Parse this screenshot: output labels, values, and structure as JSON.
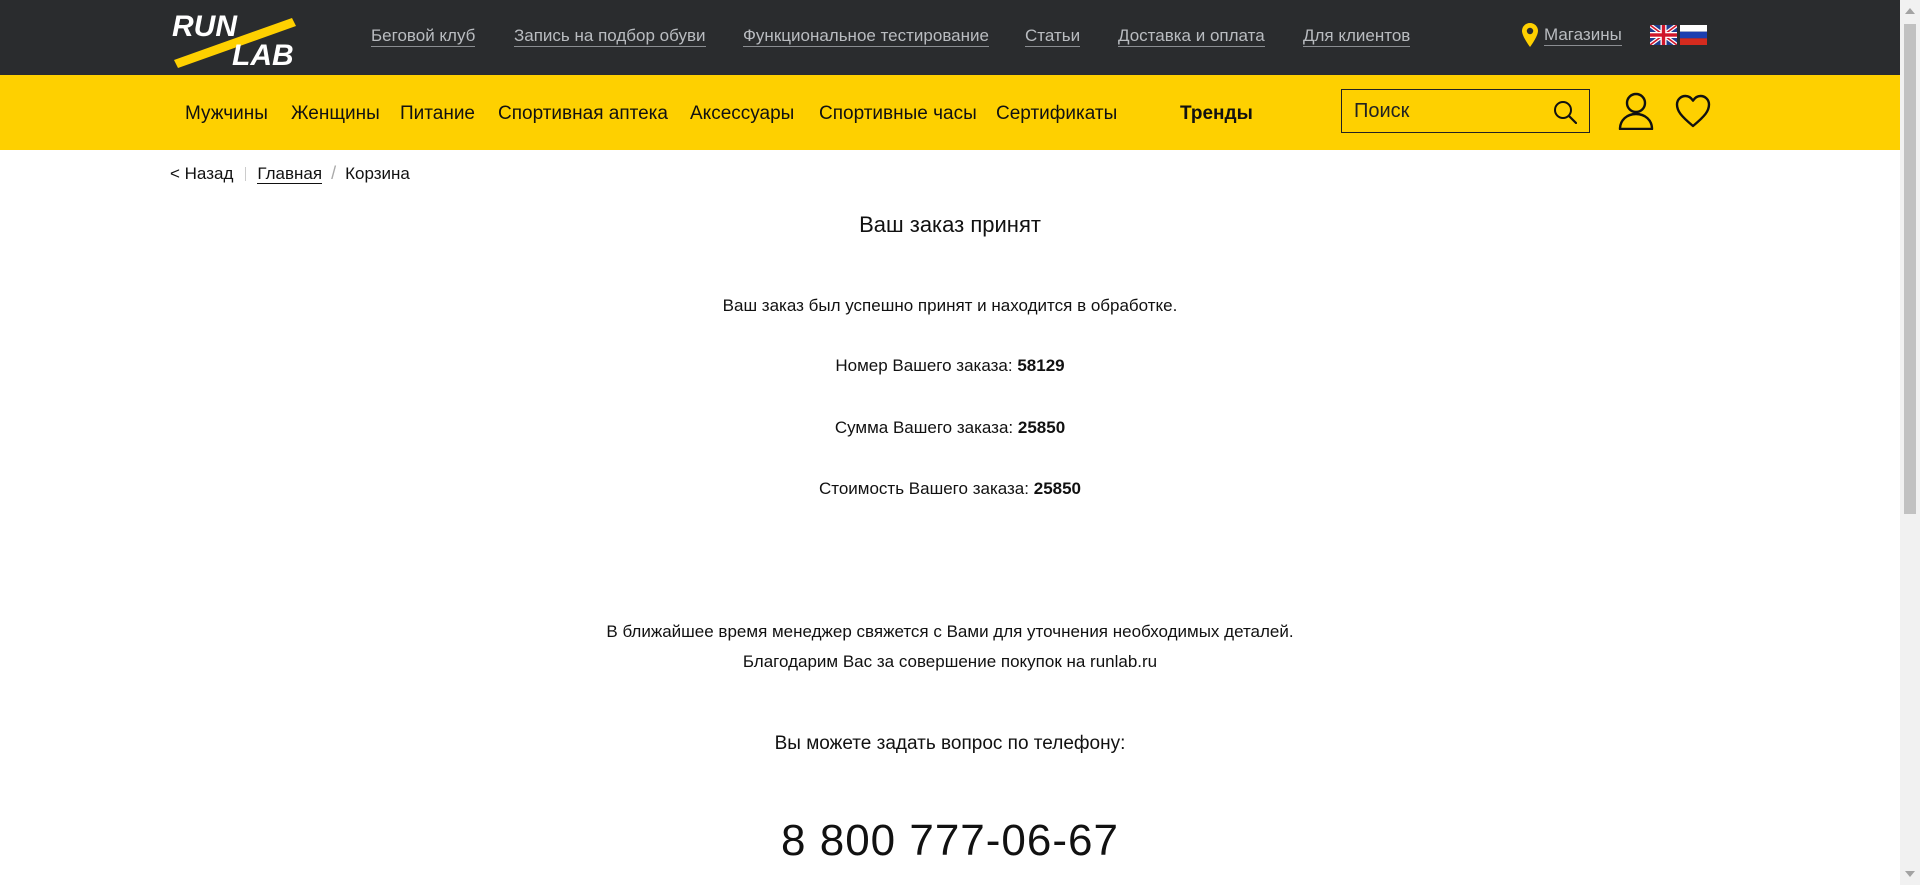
{
  "header": {
    "logo_text_top": "RUN",
    "logo_text_bottom": "LAB",
    "links": [
      "Беговой клуб",
      "Запись на подбор обуви",
      "Функциональное тестирование",
      "Статьи",
      "Доставка и оплата",
      "Для клиентов"
    ],
    "stores_label": "Магазины"
  },
  "nav": {
    "categories": [
      "Мужчины",
      "Женщины",
      "Питание",
      "Спортивная аптека",
      "Аксессуары",
      "Спортивные часы",
      "Сертификаты"
    ],
    "trends": "Тренды",
    "search_placeholder": "Поиск"
  },
  "breadcrumb": {
    "back": "< Назад",
    "home": "Главная",
    "current": "Корзина"
  },
  "order": {
    "title": "Ваш заказ принят",
    "message": "Ваш заказ был успешно принят и находится в обработке.",
    "number_label": "Номер Вашего заказа:",
    "number_value": "58129",
    "sum_label": "Сумма Вашего заказа:",
    "sum_value": "25850",
    "cost_label": "Стоимость Вашего заказа:",
    "cost_value": "25850",
    "manager_note": "В ближайшее время менеджер свяжется с Вами для уточнения необходимых деталей.",
    "thanks": "Благодарим Вас за совершение покупок на runlab.ru",
    "phone_prompt": "Вы можете задать вопрос по телефону:",
    "phone": "8 800 777-06-67"
  },
  "colors": {
    "topbar": "#2a2c2e",
    "accent_yellow": "#fed000",
    "link_gray": "#b9bcc0"
  }
}
